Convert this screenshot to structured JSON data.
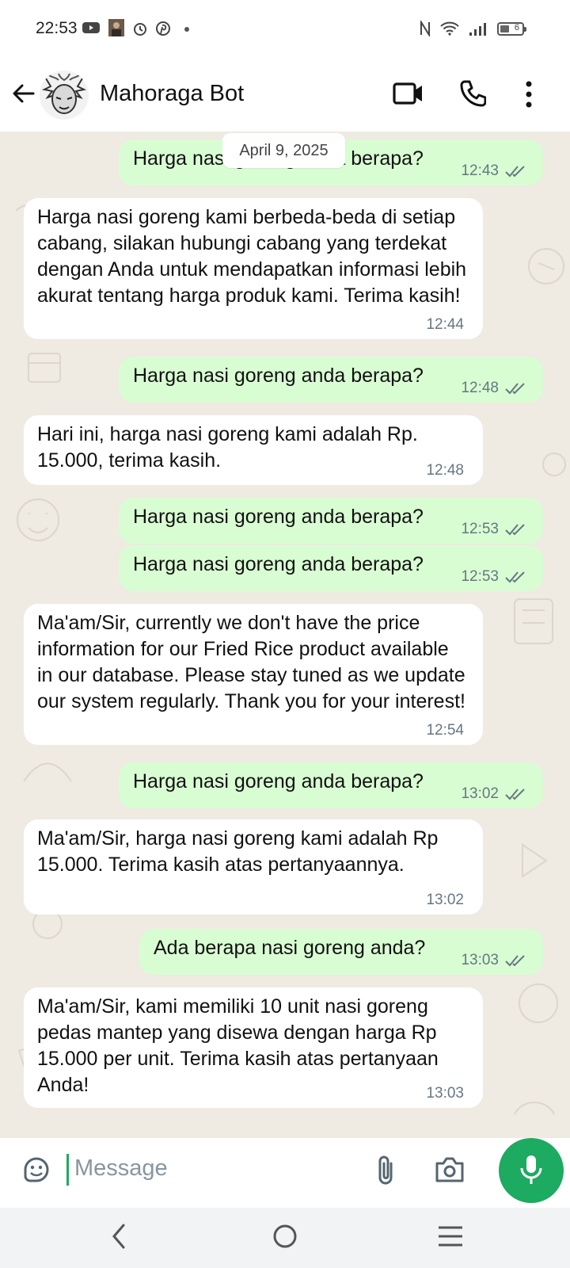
{
  "status_bar": {
    "time": "22:53",
    "battery_level": "6",
    "icons": [
      "youtube-icon",
      "photo-icon",
      "alarm-icon",
      "pinterest-icon",
      "dot-icon",
      "nfc-icon",
      "wifi-icon",
      "signal-icon",
      "battery-icon"
    ]
  },
  "header": {
    "contact_name": "Mahoraga Bot",
    "icons": [
      "back-arrow-icon",
      "video-call-icon",
      "voice-call-icon",
      "more-options-icon"
    ]
  },
  "chat": {
    "date_chip": "April 9, 2025",
    "messages": [
      {
        "direction": "out",
        "text": "Harga nasi goreng anda berapa?",
        "time": "12:43",
        "read": true
      },
      {
        "direction": "in",
        "text": " Harga nasi goreng kami berbeda-beda di setiap cabang, silakan hubungi cabang yang terdekat dengan Anda untuk mendapatkan informasi lebih akurat tentang harga produk kami. Terima kasih!",
        "time": "12:44"
      },
      {
        "direction": "out",
        "text": "Harga nasi goreng anda berapa?",
        "time": "12:48",
        "read": true
      },
      {
        "direction": "in",
        "text": " Hari ini, harga nasi goreng kami adalah Rp. 15.000, terima kasih.",
        "time": "12:48"
      },
      {
        "direction": "out",
        "text": "Harga nasi goreng anda berapa?",
        "time": "12:53",
        "read": true
      },
      {
        "direction": "out",
        "text": "Harga nasi goreng anda berapa?",
        "time": "12:53",
        "read": true
      },
      {
        "direction": "in",
        "text": " Ma'am/Sir, currently we don't have the price information for our Fried Rice product available in our database. Please stay tuned as we update our system regularly. Thank you for your interest!",
        "time": "12:54"
      },
      {
        "direction": "out",
        "text": "Harga nasi goreng anda berapa?",
        "time": "13:02",
        "read": true
      },
      {
        "direction": "in",
        "text": " Ma'am/Sir, harga nasi goreng kami adalah Rp 15.000. Terima kasih atas pertanyaannya.",
        "time": "13:02"
      },
      {
        "direction": "out",
        "text": "Ada berapa nasi goreng anda?",
        "time": "13:03",
        "read": true
      },
      {
        "direction": "in",
        "text": " Ma'am/Sir, kami memiliki 10 unit nasi goreng pedas mantep yang disewa dengan harga Rp 15.000 per unit. Terima kasih atas pertanyaan Anda!",
        "time": "13:03"
      }
    ]
  },
  "composer": {
    "placeholder": "Message",
    "icons": [
      "sticker-icon",
      "attach-icon",
      "camera-icon",
      "mic-icon"
    ]
  },
  "nav_bar": {
    "icons": [
      "nav-back-icon",
      "nav-home-icon",
      "nav-recents-icon"
    ]
  },
  "colors": {
    "outgoing_bubble": "#d9fdd3",
    "incoming_bubble": "#ffffff",
    "chat_background": "#efeae2",
    "accent_green": "#1daa61",
    "read_tick": "#667781",
    "timestamp": "#667781"
  }
}
